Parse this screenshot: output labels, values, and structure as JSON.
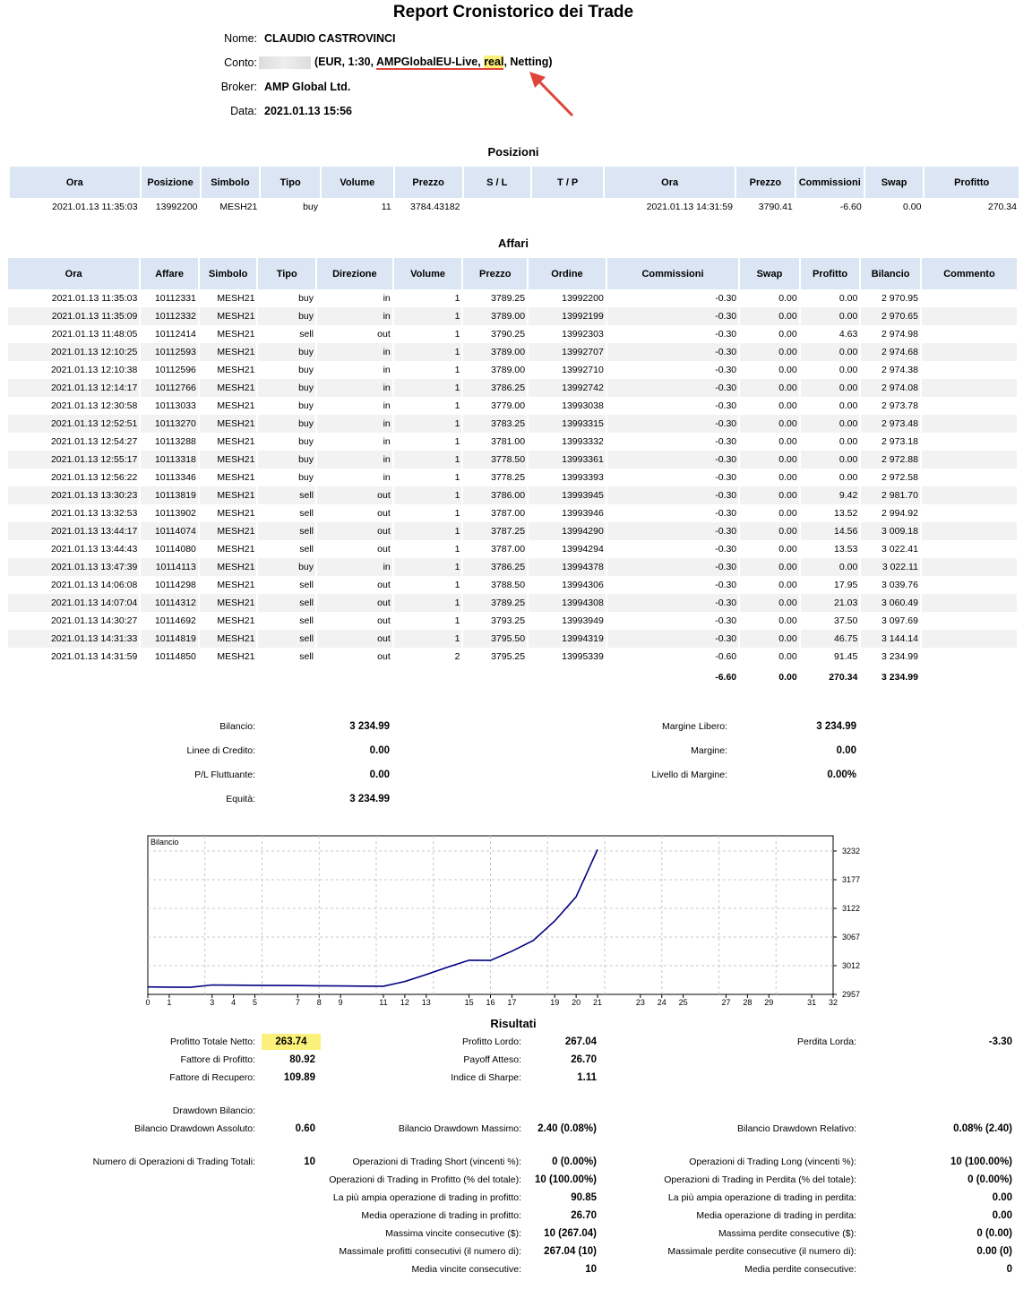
{
  "report": {
    "title": "Report Cronistorico dei Trade",
    "name_label": "Nome:",
    "name": "CLAUDIO CASTROVINCI",
    "account_label": "Conto:",
    "account_open": "(EUR, 1:30, ",
    "account_server": "AMPGlobalEU-Live",
    "account_sep": ", ",
    "account_type": "real",
    "account_rest": ", Netting)",
    "broker_label": "Broker:",
    "broker": "AMP Global Ltd.",
    "date_label": "Data:",
    "date": "2021.01.13 15:56"
  },
  "colors": {
    "header_bg": "#dbe5f3",
    "highlight": "#fbf07a",
    "arrow": "#e0453c",
    "line": "#000080"
  },
  "positions": {
    "section_title": "Posizioni",
    "headers": [
      "Ora",
      "Posizione",
      "Simbolo",
      "Tipo",
      "Volume",
      "Prezzo",
      "S / L",
      "T / P",
      "Ora",
      "Prezzo",
      "Commissioni",
      "Swap",
      "Profitto"
    ],
    "rows": [
      [
        "2021.01.13 11:35:03",
        "13992200",
        "MESH21",
        "buy",
        "11",
        "3784.43182",
        "",
        "",
        "2021.01.13 14:31:59",
        "3790.41",
        "-6.60",
        "0.00",
        "270.34"
      ]
    ]
  },
  "deals": {
    "section_title": "Affari",
    "headers": [
      "Ora",
      "Affare",
      "Simbolo",
      "Tipo",
      "Direzione",
      "Volume",
      "Prezzo",
      "Ordine",
      "Commissioni",
      "Swap",
      "Profitto",
      "Bilancio",
      "Commento"
    ],
    "rows": [
      [
        "2021.01.13 11:35:03",
        "10112331",
        "MESH21",
        "buy",
        "in",
        "1",
        "3789.25",
        "13992200",
        "-0.30",
        "0.00",
        "0.00",
        "2 970.95",
        ""
      ],
      [
        "2021.01.13 11:35:09",
        "10112332",
        "MESH21",
        "buy",
        "in",
        "1",
        "3789.00",
        "13992199",
        "-0.30",
        "0.00",
        "0.00",
        "2 970.65",
        ""
      ],
      [
        "2021.01.13 11:48:05",
        "10112414",
        "MESH21",
        "sell",
        "out",
        "1",
        "3790.25",
        "13992303",
        "-0.30",
        "0.00",
        "4.63",
        "2 974.98",
        ""
      ],
      [
        "2021.01.13 12:10:25",
        "10112593",
        "MESH21",
        "buy",
        "in",
        "1",
        "3789.00",
        "13992707",
        "-0.30",
        "0.00",
        "0.00",
        "2 974.68",
        ""
      ],
      [
        "2021.01.13 12:10:38",
        "10112596",
        "MESH21",
        "buy",
        "in",
        "1",
        "3789.00",
        "13992710",
        "-0.30",
        "0.00",
        "0.00",
        "2 974.38",
        ""
      ],
      [
        "2021.01.13 12:14:17",
        "10112766",
        "MESH21",
        "buy",
        "in",
        "1",
        "3786.25",
        "13992742",
        "-0.30",
        "0.00",
        "0.00",
        "2 974.08",
        ""
      ],
      [
        "2021.01.13 12:30:58",
        "10113033",
        "MESH21",
        "buy",
        "in",
        "1",
        "3779.00",
        "13993038",
        "-0.30",
        "0.00",
        "0.00",
        "2 973.78",
        ""
      ],
      [
        "2021.01.13 12:52:51",
        "10113270",
        "MESH21",
        "buy",
        "in",
        "1",
        "3783.25",
        "13993315",
        "-0.30",
        "0.00",
        "0.00",
        "2 973.48",
        ""
      ],
      [
        "2021.01.13 12:54:27",
        "10113288",
        "MESH21",
        "buy",
        "in",
        "1",
        "3781.00",
        "13993332",
        "-0.30",
        "0.00",
        "0.00",
        "2 973.18",
        ""
      ],
      [
        "2021.01.13 12:55:17",
        "10113318",
        "MESH21",
        "buy",
        "in",
        "1",
        "3778.50",
        "13993361",
        "-0.30",
        "0.00",
        "0.00",
        "2 972.88",
        ""
      ],
      [
        "2021.01.13 12:56:22",
        "10113346",
        "MESH21",
        "buy",
        "in",
        "1",
        "3778.25",
        "13993393",
        "-0.30",
        "0.00",
        "0.00",
        "2 972.58",
        ""
      ],
      [
        "2021.01.13 13:30:23",
        "10113819",
        "MESH21",
        "sell",
        "out",
        "1",
        "3786.00",
        "13993945",
        "-0.30",
        "0.00",
        "9.42",
        "2 981.70",
        ""
      ],
      [
        "2021.01.13 13:32:53",
        "10113902",
        "MESH21",
        "sell",
        "out",
        "1",
        "3787.00",
        "13993946",
        "-0.30",
        "0.00",
        "13.52",
        "2 994.92",
        ""
      ],
      [
        "2021.01.13 13:44:17",
        "10114074",
        "MESH21",
        "sell",
        "out",
        "1",
        "3787.25",
        "13994290",
        "-0.30",
        "0.00",
        "14.56",
        "3 009.18",
        ""
      ],
      [
        "2021.01.13 13:44:43",
        "10114080",
        "MESH21",
        "sell",
        "out",
        "1",
        "3787.00",
        "13994294",
        "-0.30",
        "0.00",
        "13.53",
        "3 022.41",
        ""
      ],
      [
        "2021.01.13 13:47:39",
        "10114113",
        "MESH21",
        "buy",
        "in",
        "1",
        "3786.25",
        "13994378",
        "-0.30",
        "0.00",
        "0.00",
        "3 022.11",
        ""
      ],
      [
        "2021.01.13 14:06:08",
        "10114298",
        "MESH21",
        "sell",
        "out",
        "1",
        "3788.50",
        "13994306",
        "-0.30",
        "0.00",
        "17.95",
        "3 039.76",
        ""
      ],
      [
        "2021.01.13 14:07:04",
        "10114312",
        "MESH21",
        "sell",
        "out",
        "1",
        "3789.25",
        "13994308",
        "-0.30",
        "0.00",
        "21.03",
        "3 060.49",
        ""
      ],
      [
        "2021.01.13 14:30:27",
        "10114692",
        "MESH21",
        "sell",
        "out",
        "1",
        "3793.25",
        "13993949",
        "-0.30",
        "0.00",
        "37.50",
        "3 097.69",
        ""
      ],
      [
        "2021.01.13 14:31:33",
        "10114819",
        "MESH21",
        "sell",
        "out",
        "1",
        "3795.50",
        "13994319",
        "-0.30",
        "0.00",
        "46.75",
        "3 144.14",
        ""
      ],
      [
        "2021.01.13 14:31:59",
        "10114850",
        "MESH21",
        "sell",
        "out",
        "2",
        "3795.25",
        "13995339",
        "-0.60",
        "0.00",
        "91.45",
        "3 234.99",
        ""
      ]
    ],
    "totals": [
      "",
      "",
      "",
      "",
      "",
      "",
      "",
      "",
      "-6.60",
      "0.00",
      "270.34",
      "3 234.99",
      ""
    ]
  },
  "summary": {
    "left": [
      {
        "label": "Bilancio:",
        "value": "3 234.99"
      },
      {
        "label": "Linee di Credito:",
        "value": "0.00"
      },
      {
        "label": "P/L Fluttuante:",
        "value": "0.00"
      },
      {
        "label": "Equità:",
        "value": "3 234.99"
      }
    ],
    "right": [
      {
        "label": "Margine Libero:",
        "value": "3 234.99"
      },
      {
        "label": "Margine:",
        "value": "0.00"
      },
      {
        "label": "Livello di Margine:",
        "value": "0.00%"
      }
    ]
  },
  "chart_data": {
    "type": "line",
    "title": "Bilancio",
    "x": [
      0,
      1,
      2,
      3,
      4,
      5,
      6,
      7,
      8,
      9,
      10,
      11,
      12,
      13,
      14,
      15,
      16,
      17,
      18,
      19,
      20,
      21
    ],
    "values": [
      2970.95,
      2970.65,
      2974.98,
      2974.68,
      2974.38,
      2974.08,
      2973.78,
      2973.48,
      2973.18,
      2972.88,
      2972.58,
      2981.7,
      2994.92,
      3009.18,
      3022.41,
      3022.11,
      3039.76,
      3060.49,
      3097.69,
      3144.14,
      3234.99
    ],
    "x_index": [
      0,
      1,
      2,
      3,
      4,
      5,
      6,
      7,
      8,
      9,
      10,
      11,
      12,
      13,
      14,
      15,
      16,
      17,
      18,
      19,
      20
    ],
    "xlim": [
      0,
      32
    ],
    "ylim": [
      2957,
      3232
    ],
    "yticks": [
      2957,
      3012,
      3067,
      3122,
      3177,
      3232
    ],
    "xticks": [
      0,
      1,
      3,
      4,
      5,
      7,
      8,
      9,
      11,
      12,
      13,
      15,
      16,
      17,
      19,
      20,
      21,
      23,
      24,
      25,
      27,
      28,
      29,
      31,
      32
    ],
    "grid": true
  },
  "results": {
    "section_title": "Risultati",
    "col1": [
      {
        "label": "Profitto Totale Netto:",
        "value": "263.74",
        "y": 1163,
        "hl": true
      },
      {
        "label": "Fattore di Profitto:",
        "value": "80.92",
        "y": 1183
      },
      {
        "label": "Fattore di Recupero:",
        "value": "109.89",
        "y": 1203
      },
      {
        "label": "Drawdown Bilancio:",
        "value": "",
        "y": 1240
      },
      {
        "label": "Bilancio Drawdown Assoluto:",
        "value": "0.60",
        "y": 1260
      },
      {
        "label": "Numero di Operazioni di Trading Totali:",
        "value": "10",
        "y": 1297
      }
    ],
    "col2": [
      {
        "label": "Profitto Lordo:",
        "value": "267.04",
        "y": 1163
      },
      {
        "label": "Payoff Atteso:",
        "value": "26.70",
        "y": 1183
      },
      {
        "label": "Indice di Sharpe:",
        "value": "1.11",
        "y": 1203
      },
      {
        "label": "Bilancio Drawdown Massimo:",
        "value": "2.40 (0.08%)",
        "y": 1260
      },
      {
        "label": "Operazioni di Trading Short (vincenti %):",
        "value": "0 (0.00%)",
        "y": 1297
      },
      {
        "label": "Operazioni di Trading in Profitto (% del totale):",
        "value": "10 (100.00%)",
        "y": 1317
      },
      {
        "label": "La più ampia operazione di trading in profitto:",
        "value": "90.85",
        "y": 1337
      },
      {
        "label": "Media operazione di trading in profitto:",
        "value": "26.70",
        "y": 1357
      },
      {
        "label": "Massima vincite consecutive ($):",
        "value": "10 (267.04)",
        "y": 1377
      },
      {
        "label": "Massimale profitti consecutivi (il numero di):",
        "value": "267.04 (10)",
        "y": 1397
      },
      {
        "label": "Media vincite consecutive:",
        "value": "10",
        "y": 1417
      }
    ],
    "col3": [
      {
        "label": "Perdita Lorda:",
        "value": "-3.30",
        "y": 1163
      },
      {
        "label": "Bilancio Drawdown Relativo:",
        "value": "0.08% (2.40)",
        "y": 1260
      },
      {
        "label": "Operazioni di Trading Long (vincenti %):",
        "value": "10 (100.00%)",
        "y": 1297
      },
      {
        "label": "Operazioni di Trading in Perdita (% del totale):",
        "value": "0 (0.00%)",
        "y": 1317
      },
      {
        "label": "La più ampia operazione di trading in perdita:",
        "value": "0.00",
        "y": 1337
      },
      {
        "label": "Media operazione di trading in perdita:",
        "value": "0.00",
        "y": 1357
      },
      {
        "label": "Massima perdite consecutive ($):",
        "value": "0 (0.00)",
        "y": 1377
      },
      {
        "label": "Massimale perdite consecutive (il numero di):",
        "value": "0.00 (0)",
        "y": 1397
      },
      {
        "label": "Media perdite consecutive:",
        "value": "0",
        "y": 1417
      }
    ]
  }
}
